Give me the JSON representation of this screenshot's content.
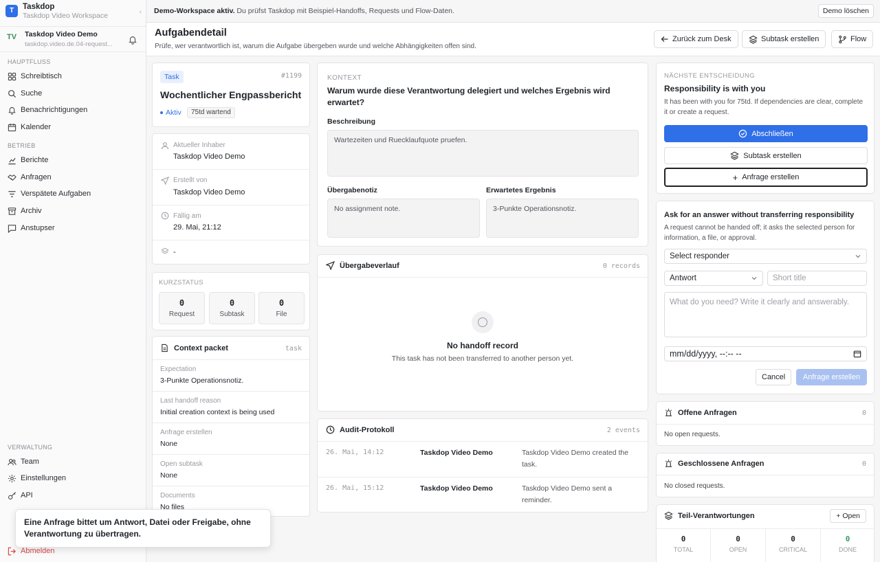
{
  "workspace": {
    "logo": "T",
    "name": "Taskdop",
    "subtitle": "Taskdop Video Workspace"
  },
  "user": {
    "initials": "TV",
    "name": "Taskdop Video Demo",
    "email": "taskdop.video.de.04-request..."
  },
  "sidebar": {
    "section_main": "HAUPTFLUSS",
    "main_items": [
      {
        "label": "Schreibtisch",
        "icon": "desk-icon"
      },
      {
        "label": "Suche",
        "icon": "search-icon"
      },
      {
        "label": "Benachrichtigungen",
        "icon": "bell-icon"
      },
      {
        "label": "Kalender",
        "icon": "calendar-icon"
      }
    ],
    "section_ops": "BETRIEB",
    "ops_items": [
      {
        "label": "Berichte",
        "icon": "chart-icon"
      },
      {
        "label": "Anfragen",
        "icon": "handshake-icon"
      },
      {
        "label": "Verspätete Aufgaben",
        "icon": "filter-icon"
      },
      {
        "label": "Archiv",
        "icon": "archive-icon"
      },
      {
        "label": "Anstupser",
        "icon": "message-icon"
      }
    ],
    "section_admin": "VERWALTUNG",
    "admin_items": [
      {
        "label": "Team",
        "icon": "team-icon"
      },
      {
        "label": "Einstellungen",
        "icon": "gear-icon"
      },
      {
        "label": "API",
        "icon": "key-icon"
      }
    ],
    "logout": "Abmelden"
  },
  "tooltip": "Eine Anfrage bittet um Antwort, Datei oder Freigabe, ohne Verantwortung zu übertragen.",
  "banner": {
    "strong": "Demo-Workspace aktiv.",
    "text": " Du prüfst Taskdop mit Beispiel-Handoffs, Requests und Flow-Daten.",
    "button": "Demo löschen"
  },
  "header": {
    "title": "Aufgabendetail",
    "subtitle": "Prüfe, wer verantwortlich ist, warum die Aufgabe übergeben wurde und welche Abhängigkeiten offen sind.",
    "back": "Zurück zum Desk",
    "subtask": "Subtask erstellen",
    "flow": "Flow"
  },
  "task": {
    "badge": "Task",
    "id": "#1199",
    "title": "Wochentlicher Engpassbericht",
    "status": "Aktiv",
    "waiting": "75td wartend"
  },
  "details": {
    "owner_label": "Aktueller Inhaber",
    "owner": "Taskdop Video Demo",
    "creator_label": "Erstellt von",
    "creator": "Taskdop Video Demo",
    "due_label": "Fällig am",
    "due": "29. Mai, 21:12",
    "stack": "-"
  },
  "kurzstatus": {
    "label": "KURZSTATUS",
    "items": [
      {
        "n": "0",
        "l": "Request"
      },
      {
        "n": "0",
        "l": "Subtask"
      },
      {
        "n": "0",
        "l": "File"
      }
    ]
  },
  "context_packet": {
    "title": "Context packet",
    "tag": "task",
    "rows": [
      {
        "k": "Expectation",
        "v": "3-Punkte Operationsnotiz."
      },
      {
        "k": "Last handoff reason",
        "v": "Initial creation context is being used"
      },
      {
        "k": "Anfrage erstellen",
        "v": "None"
      },
      {
        "k": "Open subtask",
        "v": "None"
      },
      {
        "k": "Documents",
        "v": "No files"
      }
    ]
  },
  "context": {
    "eyebrow": "KONTEXT",
    "question": "Warum wurde diese Verantwortung delegiert und welches Ergebnis wird erwartet?",
    "desc_label": "Beschreibung",
    "desc": "Wartezeiten und Ruecklaufquote pruefen.",
    "note_label": "Übergabenotiz",
    "note": "No assignment note.",
    "result_label": "Erwartetes Ergebnis",
    "result": "3-Punkte Operationsnotiz."
  },
  "handoff": {
    "title": "Übergabeverlauf",
    "count": "0 records",
    "empty_title": "No handoff record",
    "empty_text": "This task has not been transferred to another person yet."
  },
  "audit": {
    "title": "Audit-Protokoll",
    "count": "2 events",
    "rows": [
      {
        "time": "26. Mai, 14:12",
        "who": "Taskdop Video Demo",
        "what": "Taskdop Video Demo created the task."
      },
      {
        "time": "26. Mai, 15:12",
        "who": "Taskdop Video Demo",
        "what": "Taskdop Video Demo sent a reminder."
      }
    ]
  },
  "decision": {
    "eyebrow": "NÄCHSTE ENTSCHEIDUNG",
    "title": "Responsibility is with you",
    "text": "It has been with you for 75td. If dependencies are clear, complete it or create a request.",
    "complete": "Abschließen",
    "subtask": "Subtask erstellen",
    "request": "Anfrage erstellen"
  },
  "ask": {
    "title": "Ask for an answer without transferring responsibility",
    "text": "A request cannot be handed off; it asks the selected person for information, a file, or approval.",
    "responder": "Select responder",
    "type": "Antwort",
    "short_title_ph": "Short title",
    "message_ph": "What do you need? Write it clearly and answerably.",
    "date": "mm/dd/yyyy, --:-- --",
    "cancel": "Cancel",
    "submit": "Anfrage erstellen"
  },
  "open_requests": {
    "title": "Offene Anfragen",
    "count": "0",
    "empty": "No open requests."
  },
  "closed_requests": {
    "title": "Geschlossene Anfragen",
    "count": "0",
    "empty": "No closed requests."
  },
  "sub_resp": {
    "title": "Teil-Verantwortungen",
    "open_btn": "Open",
    "stats": [
      {
        "n": "0",
        "l": "TOTAL"
      },
      {
        "n": "0",
        "l": "OPEN"
      },
      {
        "n": "0",
        "l": "CRITICAL"
      },
      {
        "n": "0",
        "l": "DONE"
      }
    ]
  },
  "colors": {
    "accent": "#2f6fe8",
    "done": "#3d9a63",
    "danger": "#d94a4a"
  }
}
